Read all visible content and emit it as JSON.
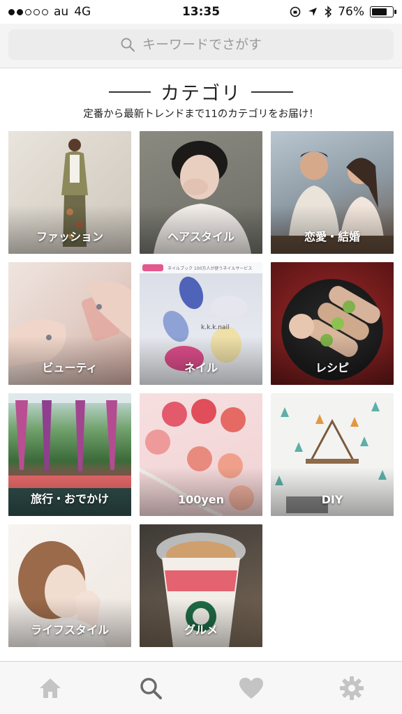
{
  "status_bar": {
    "carrier": "au",
    "network": "4G",
    "time": "13:35",
    "battery_percent": "76%",
    "battery_level": 0.76,
    "signal_bars_filled": 2,
    "signal_bars_total": 5
  },
  "search": {
    "placeholder": "キーワードでさがす",
    "icon": "search-icon"
  },
  "heading": {
    "title": "カテゴリ",
    "subtitle": "定番から最新トレンドまで11のカテゴリをお届け！"
  },
  "categories": [
    {
      "label": "ファッション"
    },
    {
      "label": "ヘアスタイル"
    },
    {
      "label": "恋愛・結婚"
    },
    {
      "label": "ビューティ"
    },
    {
      "label": "ネイル"
    },
    {
      "label": "レシピ"
    },
    {
      "label": "旅行・おでかけ"
    },
    {
      "label": "100yen"
    },
    {
      "label": "DIY"
    },
    {
      "label": "ライフスタイル"
    },
    {
      "label": "グルメ"
    }
  ],
  "tab_bar": {
    "tabs": [
      {
        "icon": "home-icon",
        "active": false
      },
      {
        "icon": "search-icon",
        "active": true
      },
      {
        "icon": "heart-icon",
        "active": false
      },
      {
        "icon": "gear-icon",
        "active": false
      }
    ],
    "active_color": "#6b6b6b",
    "inactive_color": "#c4c4c4"
  },
  "nail_banner_text": "ネイルブック 100万人が使うネイルサービス",
  "nail_art_text": "k.k.k.nail",
  "colors": {
    "background": "#ffffff",
    "search_bg": "#ececec",
    "text": "#222222",
    "muted": "#9a9a9a"
  }
}
